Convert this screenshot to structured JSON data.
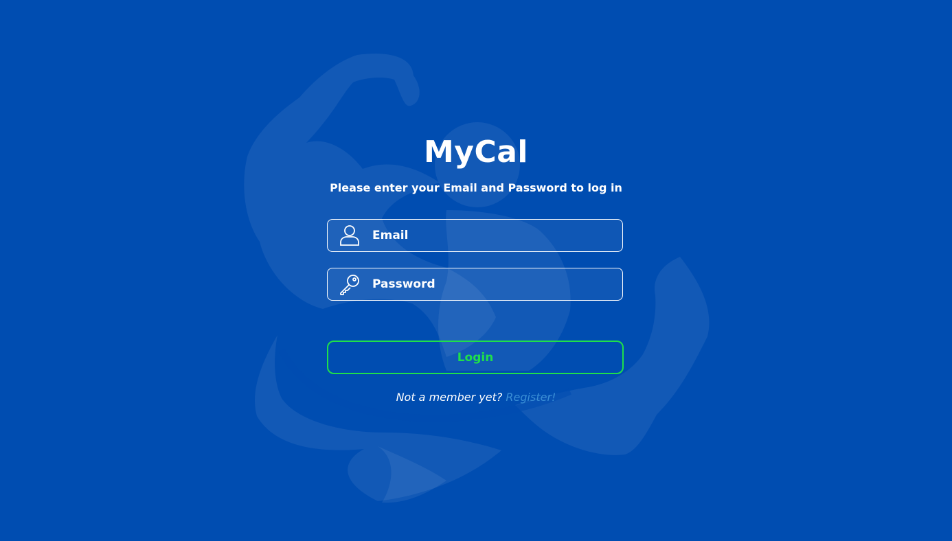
{
  "app": {
    "title": "MyCal",
    "subtitle": "Please enter your Email and Password to log in"
  },
  "form": {
    "email": {
      "placeholder": "Email",
      "value": "",
      "icon": "user-icon"
    },
    "password": {
      "placeholder": "Password",
      "value": "",
      "icon": "key-icon"
    },
    "login_label": "Login"
  },
  "register": {
    "prompt": "Not a member yet?",
    "link_label": "Register!"
  },
  "colors": {
    "background": "#004db1",
    "accent_green": "#1fe04a",
    "link_blue": "#3a8fd6",
    "text": "#ffffff"
  }
}
